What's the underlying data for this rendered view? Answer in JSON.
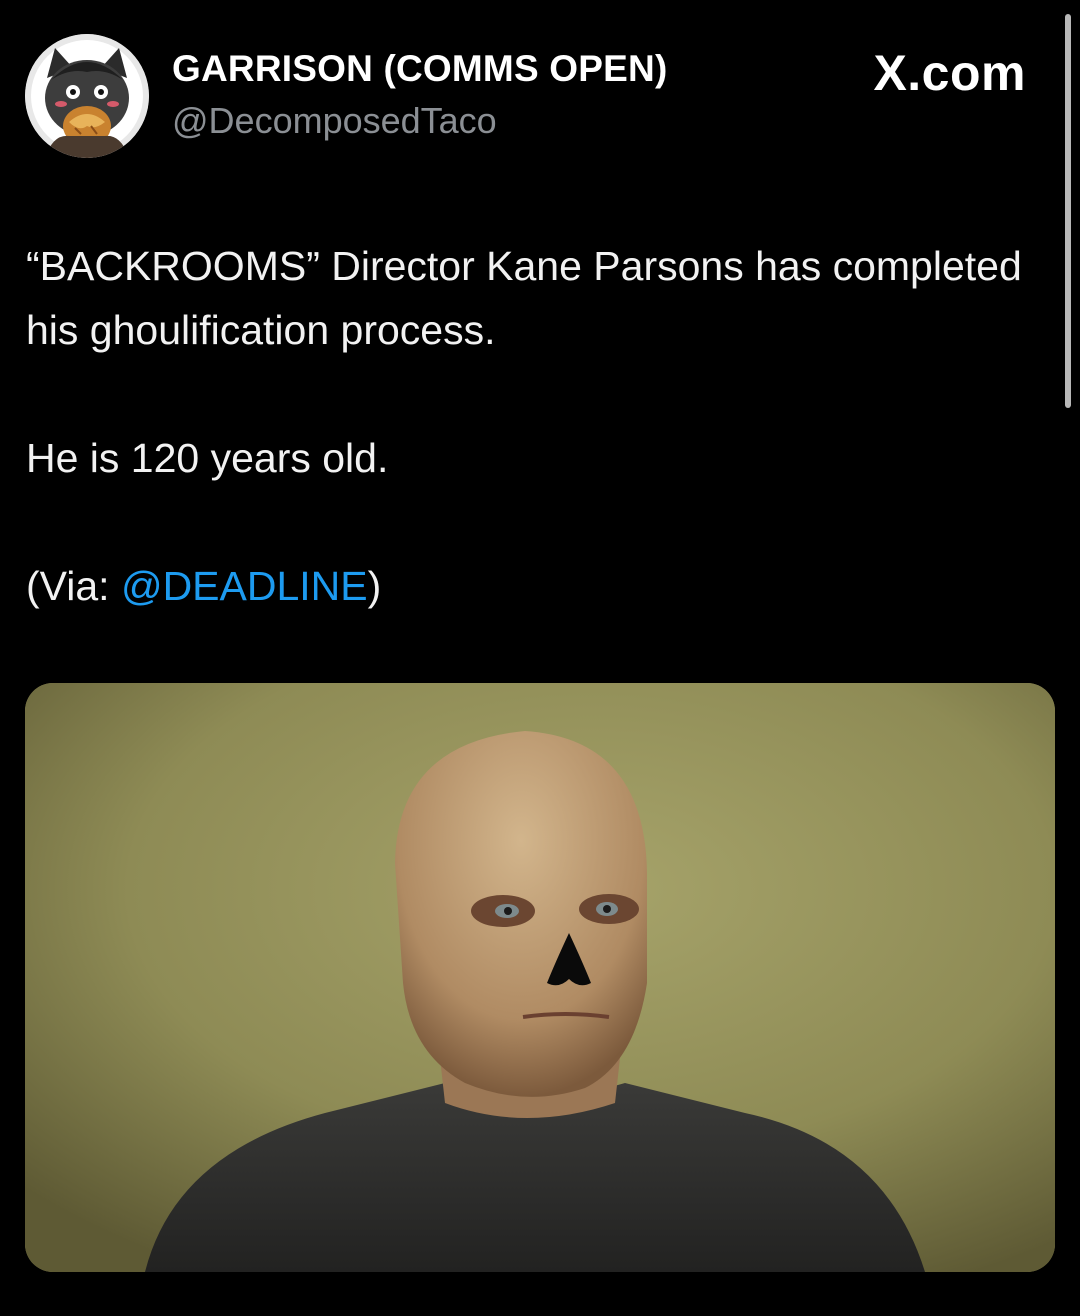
{
  "header": {
    "display_name": "GARRISON (COMMS OPEN)",
    "handle": "@DecomposedTaco",
    "brand": "X.com"
  },
  "tweet": {
    "line1": "“BACKROOMS” Director Kane Parsons has completed his ghoulification process.",
    "line2": "He is 120 years old.",
    "line3_prefix": "(Via: ",
    "line3_mention": "@DEADLINE",
    "line3_suffix": ")"
  },
  "icons": {
    "avatar": "avatar-cartoon-icon"
  },
  "colors": {
    "background": "#000000",
    "mention": "#1d9bf0",
    "handle": "#8b8f94"
  }
}
